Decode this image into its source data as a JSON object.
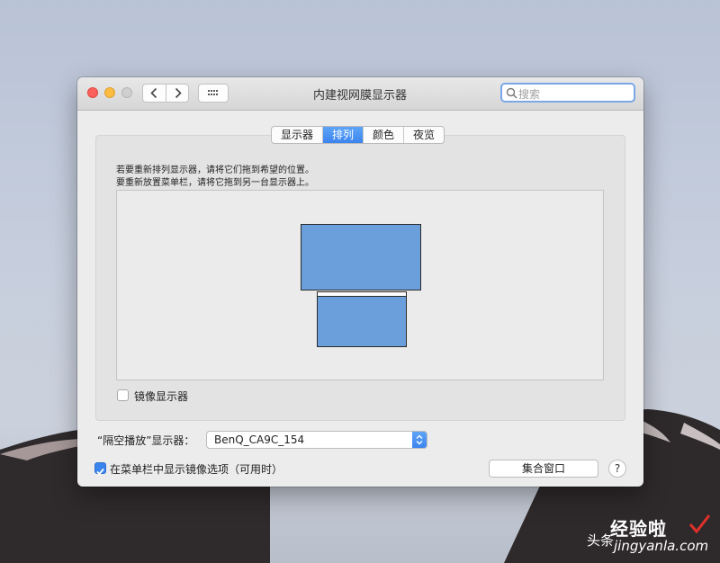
{
  "window": {
    "title": "内建视网膜显示器",
    "search_placeholder": "搜索"
  },
  "tabs": [
    {
      "label": "显示器",
      "active": false
    },
    {
      "label": "排列",
      "active": true
    },
    {
      "label": "颜色",
      "active": false
    },
    {
      "label": "夜览",
      "active": false
    }
  ],
  "arrangement": {
    "instruction_line1": "若要重新排列显示器，请将它们拖到希望的位置。",
    "instruction_line2": "要重新放置菜单栏，请将它拖到另一台显示器上。"
  },
  "mirror": {
    "label": "镜像显示器",
    "checked": false
  },
  "airplay": {
    "label": "“隔空播放”显示器：",
    "selected": "BenQ_CA9C_154"
  },
  "menu_option": {
    "label": "在菜单栏中显示镜像选项（可用时）",
    "checked": true
  },
  "buttons": {
    "gather": "集合窗口",
    "help": "?"
  },
  "watermark": {
    "brand": "经验啦",
    "prefix": "头条",
    "url": "jingyanla.com"
  },
  "colors": {
    "accent": "#3b84ee",
    "display_fill": "#6a9fdc"
  }
}
